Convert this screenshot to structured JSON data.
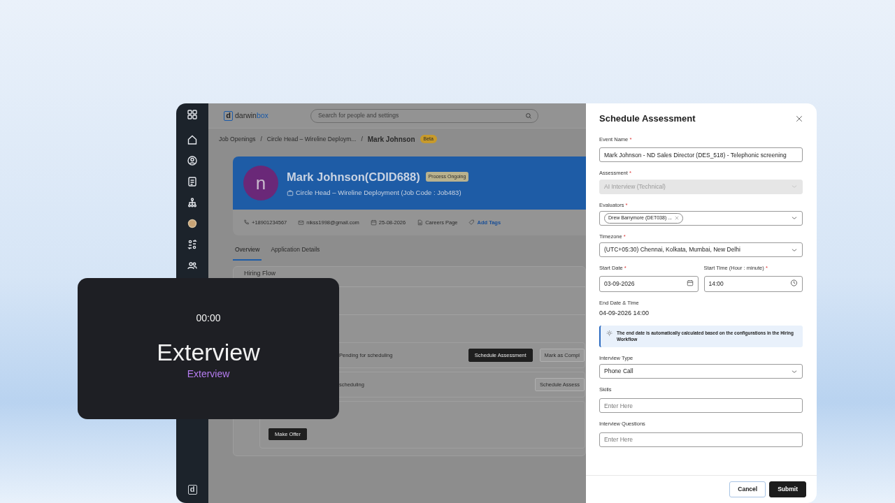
{
  "sidebar": {
    "footer_mark": "d"
  },
  "top_bar": {
    "logo": {
      "mark": "d",
      "text": "darwin",
      "text_accent": "box"
    },
    "search": {
      "placeholder": "Search for people and settings"
    }
  },
  "breadcrumb": {
    "separator": "/",
    "items": [
      {
        "label": "Job Openings",
        "current": false
      },
      {
        "label": "Circle Head – Wireline Deploym...",
        "current": false
      },
      {
        "label": "Mark Johnson",
        "current": true
      }
    ],
    "badge": "Beta"
  },
  "candidate": {
    "avatar_initial": "n",
    "name": "Mark Johnson(CDID688)",
    "status": "Process Ongoing",
    "job": "Circle Head – Wireline Deployment (Job Code : Job483)"
  },
  "contacts": [
    {
      "kind": "phone",
      "text": "+18901234567"
    },
    {
      "kind": "email",
      "text": "nikss1998@gmail.com"
    },
    {
      "kind": "date",
      "text": "25-08-2026"
    },
    {
      "kind": "source",
      "text": "Careers Page"
    },
    {
      "kind": "tags",
      "text": "Add Tags"
    }
  ],
  "tabs": [
    {
      "label": "Overview",
      "selected": true
    },
    {
      "label": "Application Details",
      "selected": false
    }
  ],
  "hiring_flow": {
    "title": "Hiring Flow",
    "stages": [
      {
        "status": "Pending for scheduling",
        "buttons": [
          {
            "label": "Schedule Assessment",
            "kind": "primary"
          },
          {
            "label": "Mark as Compl",
            "kind": "outline"
          }
        ]
      },
      {
        "status": "scheduling",
        "buttons": [
          {
            "label": "Schedule Assess",
            "kind": "outline"
          }
        ]
      },
      {
        "buttons": [
          {
            "label": "Make Offer",
            "kind": "primary"
          }
        ]
      }
    ]
  },
  "overlay_card": {
    "timer": "00:00",
    "title": "Exterview",
    "subtitle": "Exterview"
  },
  "drawer": {
    "title": "Schedule Assessment",
    "required_mark": "*",
    "fields": [
      {
        "kind": "text",
        "label": "Event Name",
        "required": true,
        "value": "Mark Johnson - ND Sales Director (DES_518) - Telephonic screening"
      },
      {
        "kind": "select",
        "label": "Assessment",
        "required": true,
        "value": "AI Interview (Technical)",
        "disabled": true
      },
      {
        "kind": "chips",
        "label": "Evaluators",
        "required": true,
        "chips": [
          "Drew Barrymore (DET038) ..."
        ]
      },
      {
        "kind": "select",
        "label": "Timezone",
        "required": true,
        "value": "(UTC+05:30) Chennai, Kolkata, Mumbai, New Delhi",
        "disabled": false
      },
      {
        "kind": "pair",
        "fields": [
          {
            "kind": "date",
            "label": "Start Date",
            "required": true,
            "value": "03-09-2026"
          },
          {
            "kind": "time",
            "label": "Start Time (Hour : minute)",
            "required": true,
            "value": "14:00"
          }
        ]
      },
      {
        "kind": "readonly",
        "label": "End Date & Time",
        "value": "04-09-2026 14:00"
      },
      {
        "kind": "note",
        "text": "The end date is automatically calculated based on the configurations in the Hiring Workflow"
      },
      {
        "kind": "select",
        "label": "Interview Type",
        "required": false,
        "value": "Phone Call",
        "disabled": false
      },
      {
        "kind": "text",
        "label": "Skills",
        "required": false,
        "placeholder": "Enter Here"
      },
      {
        "kind": "text",
        "label": "Interview Questions",
        "required": false,
        "placeholder": "Enter Here"
      }
    ],
    "buttons": [
      {
        "label": "Cancel",
        "kind": "outline"
      },
      {
        "label": "Submit",
        "kind": "primary"
      }
    ]
  }
}
